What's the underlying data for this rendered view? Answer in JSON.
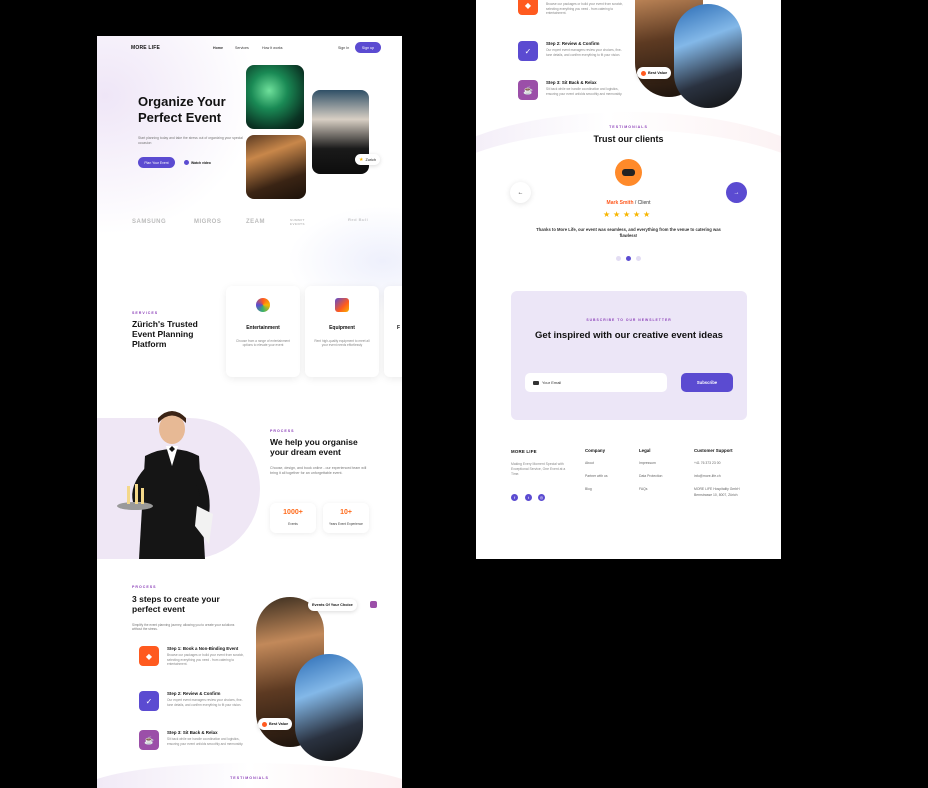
{
  "nav": {
    "logo": "MORE LIFE",
    "links": [
      "Home",
      "Services",
      "How It works"
    ],
    "sign_in": "Sign In",
    "sign_up": "Sign up"
  },
  "hero": {
    "title_line1": "Organize Your",
    "title_line2": "Perfect Event",
    "subtitle": "Start planning today and take the stress out of organizing your special occasion",
    "cta": "Plan Your Event",
    "secondary": "Watch video",
    "location_pill": "Zurich",
    "pill_icon": "star-icon"
  },
  "brands": [
    "SAMSUNG",
    "MIGROS",
    "ZEAM",
    "SUMMIT EVENTS",
    "Red Bull"
  ],
  "services": {
    "eyebrow": "SERVICES",
    "title": "Zürich's Trusted Event Planning Platform",
    "cards": [
      {
        "title": "Entertainment",
        "desc": "Choose from a range of entertainment options to elevate your event",
        "icon": "masks-icon"
      },
      {
        "title": "Equipment",
        "desc": "Rent high-quality equipment to meet all your event needs effortlessly",
        "icon": "speaker-icon"
      },
      {
        "title": "F",
        "desc": "",
        "icon": ""
      }
    ]
  },
  "process": {
    "eyebrow": "PROCESS",
    "title": "We help you organise your dream event",
    "desc": "Choose, design, and book online - our experienced team will bring it all together for an unforgettable event.",
    "stats": [
      {
        "num": "1000+",
        "label": "Events"
      },
      {
        "num": "10+",
        "label": "Years Event Experience"
      }
    ]
  },
  "steps": {
    "eyebrow": "PROCESS",
    "title": "3 steps to create your perfect event",
    "desc": "Simplify the event planning journey, allowing you to create your solutions without the stress.",
    "events_pill": "Events Of Your Choice",
    "value_pill": "Best Value",
    "items": [
      {
        "title": "Step 1: Book a Non-Binding Event",
        "desc": "Browse our packages or build your event from scratch, selecting everything you need - from catering to entertainment.",
        "color": "#ff5a1f",
        "icon": "tag-icon"
      },
      {
        "title": "Step 2: Review & Confirm",
        "desc": "Our expert event managers review your choices, fine-tune details, and confirm everything to fit your vision.",
        "color": "#5b4bd1",
        "icon": "check-icon"
      },
      {
        "title": "Step 3: Sit Back & Relax",
        "desc": "Sit back while we handle coordination and logistics, ensuring your event unfolds smoothly and memorably.",
        "color": "#9b4fa8",
        "icon": "relax-icon"
      }
    ]
  },
  "testimonials": {
    "eyebrow": "TESTIMONIALS",
    "title": "Trust our clients",
    "name": "Mark Smith",
    "role": "/ Client",
    "rating": 5,
    "quote": "Thanks to More Life, our event was seamless, and everything from the venue to catering was flawless!",
    "prev": "←",
    "next": "→"
  },
  "newsletter": {
    "eyebrow": "SUBSCRIBE TO OUR NEWSLETTER",
    "title": "Get inspired with our creative event ideas",
    "placeholder": "Your Email",
    "button": "Subscribe"
  },
  "footer": {
    "logo": "MORE LIFE",
    "about": "Making Every Moment Special with Exceptional Service, One Event at a Time.",
    "company": {
      "heading": "Company",
      "links": [
        "About",
        "Partner with us",
        "Blog"
      ]
    },
    "legal": {
      "heading": "Legal",
      "links": [
        "Impressum",
        "Data Protection",
        "FAQs"
      ]
    },
    "support": {
      "heading": "Customer Support",
      "links": [
        "+41 76 373 23 00",
        "info@more-life.ch",
        "MORE LIFE Hospitality GmbH",
        "Bernstrasse 10, 8007, Zürich"
      ]
    }
  },
  "colors": {
    "accent": "#5b4bd1",
    "orange": "#ff6a1a",
    "purple": "#8b3fb8",
    "lavender": "#ece6f7"
  }
}
